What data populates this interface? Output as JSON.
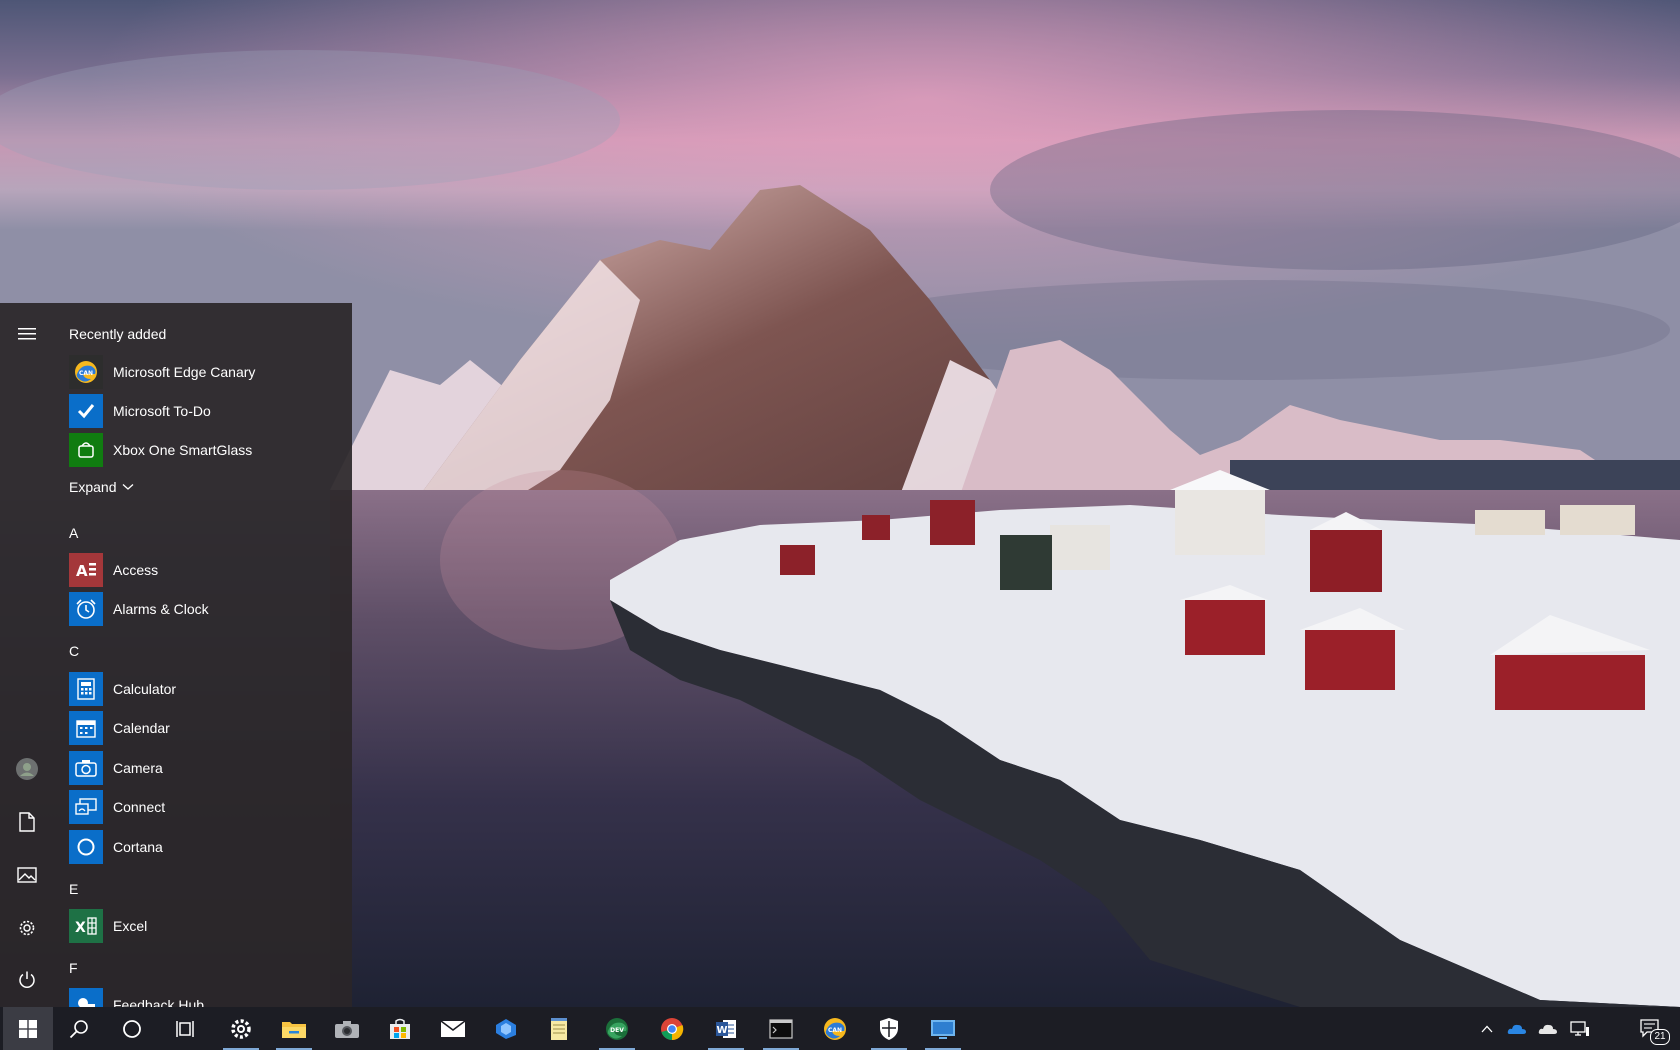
{
  "start_menu": {
    "recently_added_heading": "Recently added",
    "expand_label": "Expand",
    "recent_apps": [
      {
        "label": "Microsoft Edge Canary",
        "icon": "edge-canary-icon"
      },
      {
        "label": "Microsoft To-Do",
        "icon": "todo-check-icon"
      },
      {
        "label": "Xbox One SmartGlass",
        "icon": "xbox-smartglass-icon"
      }
    ],
    "groups": [
      {
        "letter": "A",
        "apps": [
          {
            "label": "Access",
            "icon": "access-icon"
          },
          {
            "label": "Alarms & Clock",
            "icon": "alarm-clock-icon"
          }
        ]
      },
      {
        "letter": "C",
        "apps": [
          {
            "label": "Calculator",
            "icon": "calculator-icon"
          },
          {
            "label": "Calendar",
            "icon": "calendar-icon"
          },
          {
            "label": "Camera",
            "icon": "camera-icon"
          },
          {
            "label": "Connect",
            "icon": "connect-icon"
          },
          {
            "label": "Cortana",
            "icon": "cortana-icon"
          }
        ]
      },
      {
        "letter": "E",
        "apps": [
          {
            "label": "Excel",
            "icon": "excel-icon"
          }
        ]
      },
      {
        "letter": "F",
        "apps": [
          {
            "label": "Feedback Hub",
            "icon": "feedback-hub-icon"
          }
        ]
      }
    ],
    "rail": [
      "hamburger-menu-icon",
      "user-avatar-icon",
      "documents-icon",
      "pictures-icon",
      "settings-gear-icon",
      "power-icon"
    ]
  },
  "taskbar": {
    "pinned": [
      "start-windows-icon",
      "search-icon",
      "cortana-circle-icon",
      "task-view-icon",
      "settings-gear-icon",
      "file-explorer-icon",
      "camera-icon",
      "microsoft-store-icon",
      "mail-icon",
      "visual-studio-icon",
      "notepad-icon",
      "edge-dev-icon",
      "chrome-icon",
      "word-icon",
      "terminal-icon",
      "edge-canary-icon",
      "windows-security-icon",
      "remote-desktop-icon"
    ],
    "tray": [
      "show-hidden-icons-chevron",
      "onedrive-blue-icon",
      "onedrive-white-icon",
      "network-icon"
    ],
    "notification_count": "21"
  },
  "colors": {
    "accent_blue": "#0a6ec9",
    "access_red": "#a4373a",
    "xbox_green": "#107c10",
    "excel_green": "#1e7145",
    "taskbar_bg": "#1c1d24"
  }
}
